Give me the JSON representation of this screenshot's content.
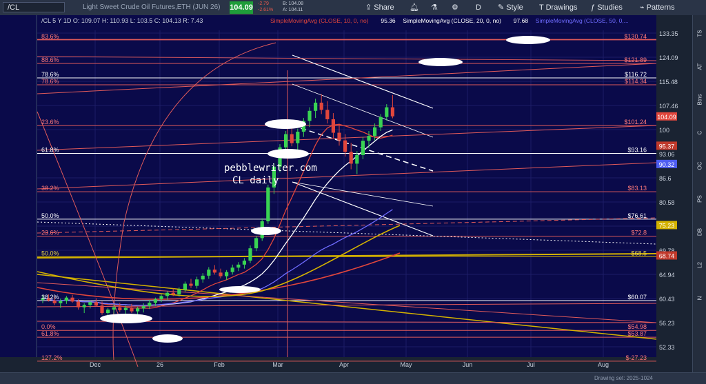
{
  "toolbar": {
    "symbol": "/CL",
    "title": "Light Sweet Crude Oil Futures,ETH (JUN 26)",
    "last": "104.09",
    "change": "-2.79",
    "change_pct": "-2.61%",
    "bid": "B: 104.08",
    "ask": "A: 104.11",
    "share": "Share",
    "period": "D",
    "style": "Style",
    "drawings": "Drawings",
    "studies": "Studies",
    "patterns": "Patterns"
  },
  "side_tabs": [
    "TS",
    "AT",
    "Btns",
    "C",
    "OC",
    "PS",
    "DB",
    "L2",
    "N"
  ],
  "footer_note": "Drawing set: 2025-1024",
  "chart_data": {
    "type": "candlestick",
    "header_text": "/CL 5 Y 1D  O: 109.07  H: 110.93  L: 103.5  C: 104.13  R: 7.43",
    "studies": [
      {
        "label": "SimpleMovingAvg (CLOSE, 10, 0, no)",
        "value": "95.36",
        "color": "#e0463c"
      },
      {
        "label": "SimpleMovingAvg (CLOSE, 20, 0, no)",
        "value": "97.68",
        "color": "#ffffff"
      },
      {
        "label": "SimpleMovingAvg (CLOSE, 50, 0,...",
        "value": "",
        "color": "#6f6cff"
      }
    ],
    "watermark": [
      "pebblewriter.com",
      "CL daily"
    ],
    "x_ticks": [
      "Dec",
      "26",
      "Feb",
      "Mar",
      "Apr",
      "May",
      "Jun",
      "Jul",
      "Aug"
    ],
    "y_ticks": [
      133.35,
      124.09,
      115.48,
      107.46,
      100,
      93.06,
      86.6,
      80.58,
      74.98,
      69.78,
      64.94,
      60.43,
      56.23,
      52.33
    ],
    "price_tags": [
      {
        "value": "104.09",
        "color": "#e0463c"
      },
      {
        "value": "95.37",
        "color": "#c0392b"
      },
      {
        "value": "90.32",
        "color": "#4e5df0"
      },
      {
        "value": "75.23",
        "color": "#d4b200"
      },
      {
        "value": "68.74",
        "color": "#c0392b"
      }
    ],
    "level_labels": [
      {
        "left": "83.6%",
        "right": "$130.74"
      },
      {
        "left": "88.6%",
        "right": "$121.89"
      },
      {
        "left": "78.6%",
        "right": "$116.72"
      },
      {
        "left": "78.6%",
        "right": "$114.34"
      },
      {
        "left": "23.6%",
        "right": "$101.24"
      },
      {
        "left": "61.8%",
        "right": "$93.16"
      },
      {
        "left": "38.2%",
        "right": "$83.13"
      },
      {
        "left": "50.0%",
        "right": "$76.61"
      },
      {
        "left": "23.6%",
        "right": "$72.8"
      },
      {
        "left": "50.0%",
        "right": "$68.5"
      },
      {
        "left": "38.2%",
        "right": "$60.07"
      },
      {
        "left": "0.0%",
        "right": "$54.98"
      },
      {
        "left": "61.8%",
        "right": "$53.87"
      },
      {
        "left": "127.2%",
        "right": "$-27.23"
      }
    ],
    "candles": [
      [
        60.2,
        61.0,
        59.6,
        60.5
      ],
      [
        60.5,
        61.2,
        59.9,
        60.1
      ],
      [
        60.1,
        60.8,
        59.3,
        59.6
      ],
      [
        59.6,
        60.4,
        58.8,
        60.0
      ],
      [
        60.0,
        60.9,
        59.5,
        60.6
      ],
      [
        60.6,
        61.1,
        59.7,
        59.9
      ],
      [
        59.9,
        60.3,
        58.5,
        58.9
      ],
      [
        58.9,
        59.6,
        57.9,
        59.3
      ],
      [
        59.3,
        60.1,
        58.7,
        59.8
      ],
      [
        59.8,
        60.5,
        59.0,
        59.2
      ],
      [
        59.2,
        59.9,
        57.6,
        57.9
      ],
      [
        57.9,
        58.8,
        57.2,
        58.5
      ],
      [
        58.5,
        59.4,
        57.8,
        58.9
      ],
      [
        58.9,
        59.7,
        58.1,
        58.4
      ],
      [
        58.4,
        59.2,
        57.5,
        58.8
      ],
      [
        58.8,
        59.5,
        57.9,
        58.2
      ],
      [
        58.2,
        59.0,
        57.4,
        58.7
      ],
      [
        58.7,
        59.6,
        58.0,
        59.1
      ],
      [
        59.1,
        60.2,
        58.6,
        59.7
      ],
      [
        59.7,
        60.6,
        59.1,
        60.3
      ],
      [
        60.3,
        61.2,
        59.8,
        60.9
      ],
      [
        60.9,
        61.8,
        60.2,
        61.5
      ],
      [
        61.5,
        62.3,
        60.9,
        61.2
      ],
      [
        61.2,
        62.5,
        60.8,
        62.1
      ],
      [
        62.1,
        63.6,
        61.7,
        63.2
      ],
      [
        63.2,
        64.1,
        62.4,
        62.8
      ],
      [
        62.8,
        64.5,
        62.3,
        64.0
      ],
      [
        64.0,
        65.2,
        63.4,
        64.7
      ],
      [
        64.7,
        66.4,
        64.1,
        65.9
      ],
      [
        65.9,
        66.8,
        64.9,
        65.3
      ],
      [
        65.3,
        66.1,
        64.2,
        64.6
      ],
      [
        64.6,
        65.8,
        63.9,
        65.4
      ],
      [
        65.4,
        66.9,
        64.9,
        66.3
      ],
      [
        66.3,
        67.4,
        65.6,
        66.9
      ],
      [
        66.9,
        68.2,
        66.1,
        67.7
      ],
      [
        67.7,
        70.8,
        67.2,
        70.2
      ],
      [
        70.2,
        72.9,
        69.6,
        72.4
      ],
      [
        72.4,
        76.8,
        71.8,
        76.1
      ],
      [
        76.1,
        84.9,
        75.5,
        84.2
      ],
      [
        84.2,
        90.5,
        82.6,
        89.6
      ],
      [
        89.6,
        95.8,
        88.1,
        94.9
      ],
      [
        94.9,
        99.6,
        92.5,
        98.7
      ],
      [
        98.7,
        102.4,
        95.2,
        96.1
      ],
      [
        96.1,
        100.3,
        93.8,
        99.4
      ],
      [
        99.4,
        103.6,
        97.9,
        102.7
      ],
      [
        102.7,
        106.9,
        100.8,
        105.8
      ],
      [
        105.8,
        109.7,
        103.6,
        108.4
      ],
      [
        108.4,
        111.2,
        104.8,
        106.1
      ],
      [
        106.1,
        108.9,
        101.9,
        103.2
      ],
      [
        103.2,
        105.1,
        97.6,
        99.1
      ],
      [
        99.1,
        101.8,
        95.4,
        96.9
      ],
      [
        96.9,
        98.7,
        92.3,
        93.6
      ],
      [
        93.6,
        96.2,
        88.9,
        90.4
      ],
      [
        90.4,
        93.8,
        87.6,
        92.7
      ],
      [
        92.7,
        97.9,
        91.6,
        96.8
      ],
      [
        96.8,
        99.6,
        94.7,
        98.2
      ],
      [
        98.2,
        101.9,
        96.9,
        100.7
      ],
      [
        100.7,
        104.8,
        99.6,
        103.9
      ],
      [
        103.9,
        107.9,
        102.8,
        106.9
      ],
      [
        106.9,
        110.9,
        103.5,
        104.1
      ]
    ]
  }
}
